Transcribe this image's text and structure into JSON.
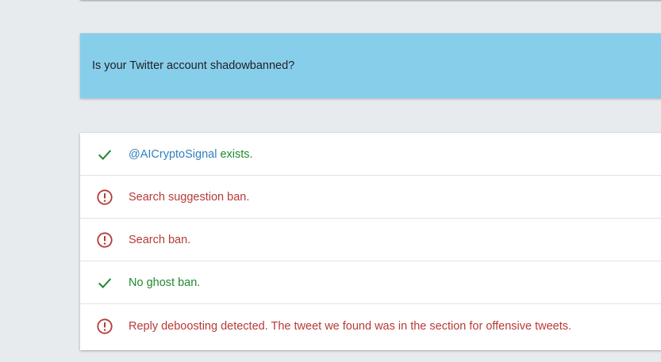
{
  "banner": {
    "title": "Is your Twitter account shadowbanned?"
  },
  "results": {
    "exists": {
      "handle": "@AICryptoSignal",
      "suffix": " exists.",
      "status": "ok"
    },
    "search_suggestion": {
      "text": "Search suggestion ban.",
      "status": "bad"
    },
    "search": {
      "text": "Search ban.",
      "status": "bad"
    },
    "ghost": {
      "text": "No ghost ban.",
      "status": "ok"
    },
    "reply": {
      "text": "Reply deboosting detected. The tweet we found was in the section for offensive tweets.",
      "status": "bad"
    }
  },
  "icons": {
    "ok": "checkmark-icon",
    "bad": "alert-circle-icon"
  },
  "colors": {
    "banner": "#87ceeb",
    "ok": "#1f8a2e",
    "bad": "#b73a37",
    "handle": "#2f7fbf"
  }
}
